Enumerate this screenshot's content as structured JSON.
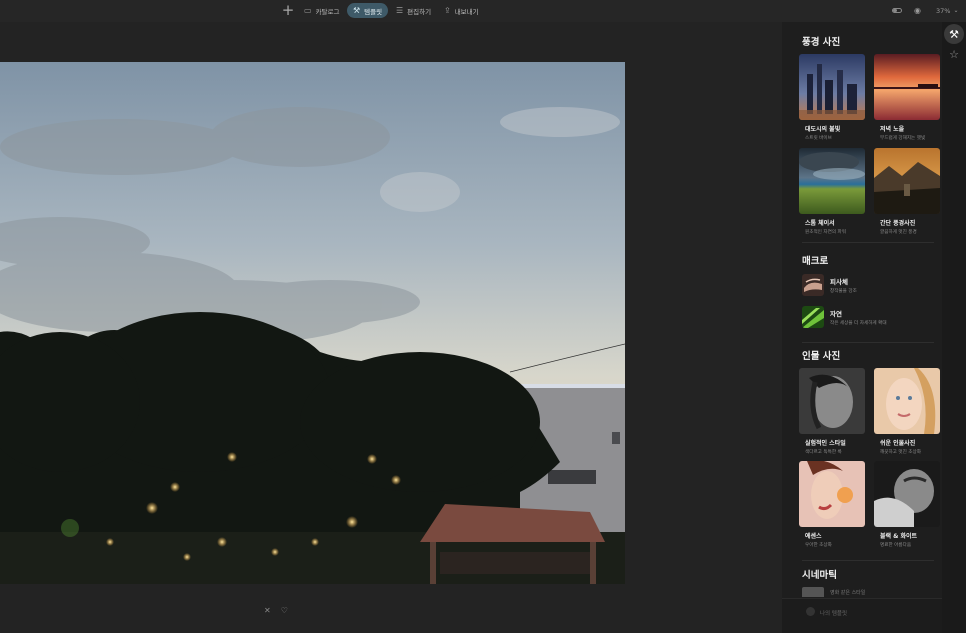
{
  "toolbar": {
    "add_icon": "plus-icon",
    "tabs": [
      {
        "label": "카탈로그",
        "icon": "folder-icon",
        "active": false
      },
      {
        "label": "템플릿",
        "icon": "magic-wand-icon",
        "active": true
      },
      {
        "label": "편집하기",
        "icon": "sliders-icon",
        "active": false
      },
      {
        "label": "내보내기",
        "icon": "share-icon",
        "active": false
      }
    ],
    "right": {
      "view_toggle_icon": "toggle-icon",
      "eye_icon": "eye-icon",
      "zoom": "37%",
      "zoom_dropdown_icon": "chevron-down-icon"
    }
  },
  "canvas": {
    "actions": [
      {
        "label": "✕",
        "icon": "reject-icon"
      },
      {
        "label": "♡",
        "icon": "heart-icon"
      }
    ]
  },
  "panel": {
    "sections": {
      "landscape": {
        "title": "풍경 사진",
        "items": [
          {
            "title": "대도시의 불빛",
            "subtitle": "스트릿 바이브"
          },
          {
            "title": "저녁 노을",
            "subtitle": "부드럽게 강해지는 햇빛"
          },
          {
            "title": "스톰 체이서",
            "subtitle": "원초적인 자연의 파워"
          },
          {
            "title": "간단 풍경사진",
            "subtitle": "깔끔하게 멋진 풍경"
          }
        ]
      },
      "macro": {
        "title": "매크로",
        "items": [
          {
            "title": "피사체",
            "subtitle": "창작물을 강조"
          },
          {
            "title": "자연",
            "subtitle": "작은 세상을 더 자세하게 확대"
          }
        ]
      },
      "portrait": {
        "title": "인물 사진",
        "items": [
          {
            "title": "실험적인 스타일",
            "subtitle": "색다르고 독특한 룩"
          },
          {
            "title": "쉬운 인물사진",
            "subtitle": "깨끗하고 멋진 초상화"
          },
          {
            "title": "에센스",
            "subtitle": "우아한 초상화"
          },
          {
            "title": "블랙 & 화이트",
            "subtitle": "명료한 아름다움"
          }
        ]
      },
      "cinematic": {
        "title": "시네마틱",
        "peek_label": "영화 같은 스타일"
      }
    },
    "footer": {
      "label": "나의 템플릿"
    }
  },
  "rail": {
    "items": [
      {
        "icon": "magic-wand-icon",
        "active": true
      },
      {
        "icon": "star-icon",
        "active": false
      }
    ]
  },
  "colors": {
    "accent": "#3e5a68",
    "background": "#1f1f1f",
    "panel": "#1e1e1e"
  }
}
